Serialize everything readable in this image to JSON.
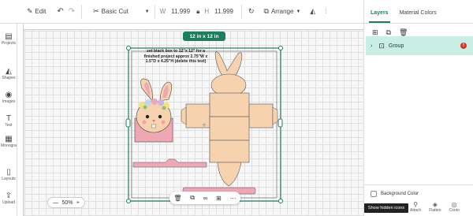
{
  "topbar": {
    "edit_label": "Edit",
    "operation_value": "Basic Cut",
    "width_label": "W",
    "width_value": "11.999",
    "height_label": "H",
    "height_value": "11.999",
    "arrange_label": "Arrange"
  },
  "left_rail": {
    "items": [
      {
        "label": "Projects",
        "icon": "projects-icon"
      },
      {
        "label": "Shapes",
        "icon": "shapes-icon"
      },
      {
        "label": "Images",
        "icon": "images-icon"
      },
      {
        "label": "Text",
        "icon": "text-icon"
      },
      {
        "label": "Monogra",
        "icon": "monogram-icon"
      },
      {
        "label": "Layouts",
        "icon": "layouts-icon"
      },
      {
        "label": "Upload",
        "icon": "upload-icon"
      }
    ]
  },
  "canvas": {
    "mat_size_label": "12 in x 12 in",
    "note_text": "set black box to 12\"x 12\" for a finished project approx 2.75\"W x 1.5\"D x 4.25\"H (delete this text)",
    "zoom_value": "50%",
    "zoom_minus": "—",
    "zoom_plus": "+"
  },
  "right_panel": {
    "tabs": [
      {
        "label": "Layers",
        "active": true
      },
      {
        "label": "Material Colors",
        "active": false
      }
    ],
    "layer_group_label": "Group",
    "background_color_label": "Background Color"
  },
  "bottom": {
    "tooltip_text": "Show hidden icons",
    "tools": [
      "Attach",
      "Flatten",
      "Conto"
    ]
  },
  "colors": {
    "accent": "#1b7f5e",
    "selection_band": "#c9efe4",
    "bunny_fill": "#f6d3ae",
    "pink_strip": "#f0a7b4"
  }
}
